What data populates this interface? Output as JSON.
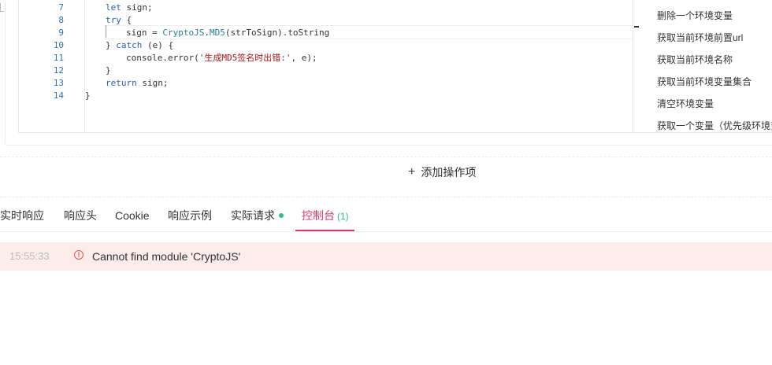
{
  "editor": {
    "lines": [
      {
        "no": "7",
        "indent": 26,
        "parts": [
          {
            "t": "let",
            "c": "kw"
          },
          {
            "t": " sign;",
            "c": ""
          }
        ]
      },
      {
        "no": "8",
        "indent": 26,
        "parts": [
          {
            "t": "try",
            "c": "kw"
          },
          {
            "t": " {",
            "c": ""
          }
        ]
      },
      {
        "no": "9",
        "indent": 52,
        "parts": [
          {
            "t": "sign = ",
            "c": ""
          },
          {
            "t": "CryptoJS",
            "c": "cls"
          },
          {
            "t": ".",
            "c": ""
          },
          {
            "t": "MD5",
            "c": "cls"
          },
          {
            "t": "(strToSign).toString",
            "c": ""
          }
        ]
      },
      {
        "no": "10",
        "indent": 26,
        "parts": [
          {
            "t": "} ",
            "c": ""
          },
          {
            "t": "catch",
            "c": "kw"
          },
          {
            "t": " (e) {",
            "c": ""
          }
        ]
      },
      {
        "no": "11",
        "indent": 52,
        "parts": [
          {
            "t": "console.error(",
            "c": ""
          },
          {
            "t": "'生成MD5签名时出错:'",
            "c": "str"
          },
          {
            "t": ", e);",
            "c": ""
          }
        ]
      },
      {
        "no": "12",
        "indent": 26,
        "parts": [
          {
            "t": "}",
            "c": ""
          }
        ]
      },
      {
        "no": "13",
        "indent": 26,
        "parts": [
          {
            "t": "return",
            "c": "kw"
          },
          {
            "t": " sign;",
            "c": ""
          }
        ]
      },
      {
        "no": "14",
        "indent": 0,
        "parts": [
          {
            "t": "}",
            "c": ""
          }
        ]
      }
    ],
    "snippets": [
      "删除一个环境变量",
      "获取当前环境前置url",
      "获取当前环境名称",
      "获取当前环境变量集合",
      "清空环境变量",
      "获取一个变量（优先级环境变量）"
    ]
  },
  "add_operation": {
    "label": "添加操作项"
  },
  "tabs": [
    {
      "label": "实时响应"
    },
    {
      "label": "响应头"
    },
    {
      "label": "Cookie"
    },
    {
      "label": "响应示例"
    },
    {
      "label": "实际请求"
    },
    {
      "label": "控制台",
      "count": "(1)"
    }
  ],
  "console": {
    "entries": [
      {
        "time": "15:55:33",
        "message": "Cannot find module 'CryptoJS'"
      }
    ]
  },
  "colors": {
    "accent": "#d63a6c",
    "success": "#2bbf8f",
    "error": "#e8564f"
  }
}
